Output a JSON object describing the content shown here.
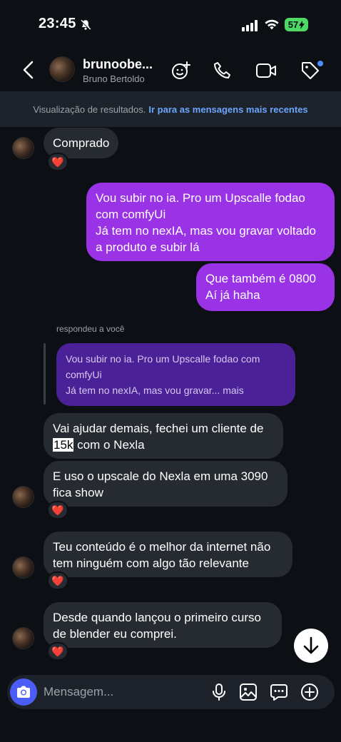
{
  "status_bar": {
    "time": "23:45",
    "battery": "57"
  },
  "header": {
    "username": "brunoobe...",
    "full_name": "Bruno Bertoldo"
  },
  "banner": {
    "text": "Visualização de resultados.",
    "link": "Ir para as mensagens mais recentes"
  },
  "messages": [
    {
      "from": "them",
      "text": "Comprado",
      "reaction": "❤️"
    },
    {
      "from": "me",
      "line1": "Vou subir no ia. Pro um Upscalle fodao",
      "line2": "com comfyUi",
      "line3": "Já tem no nexIA, mas vou gravar voltado",
      "line4": "a produto e subir lá"
    },
    {
      "from": "me",
      "line1": "Que também é 0800",
      "line2": "Aí já haha"
    },
    {
      "from": "them",
      "line1": "Vai ajudar demais, fechei um cliente de",
      "line2_highlight": "15k",
      "line2_rest": " com o Nexla"
    },
    {
      "from": "them",
      "line1": "E uso o upscale do Nexla em uma 3090",
      "line2": "fica show",
      "reaction": "❤️"
    },
    {
      "from": "them",
      "line1": "Teu conteúdo é o melhor da internet não",
      "line2": "tem ninguém com algo tão relevante",
      "reaction": "❤️"
    },
    {
      "from": "them",
      "line1": "Desde quando lançou o primeiro curso",
      "line2": "de blender eu comprei.",
      "reaction": "❤️"
    }
  ],
  "reply": {
    "label": "respondeu a você",
    "quote_line1": "Vou subir no ia. Pro um Upscalle fodao com",
    "quote_line2": "comfyUi",
    "quote_line3": "Já tem no nexIA, mas vou gravar... mais"
  },
  "composer": {
    "placeholder": "Mensagem..."
  },
  "colors": {
    "background": "#0c0f14",
    "outgoing_bubble": "#9a33e6",
    "incoming_bubble": "#262a31",
    "quote_bubble": "#4a2196",
    "link": "#6aa6ff",
    "camera_button": "#4c5cf6"
  },
  "icons": [
    "back-icon",
    "sticker-icon",
    "phone-icon",
    "video-icon",
    "tag-icon",
    "camera-icon",
    "mic-icon",
    "gallery-icon",
    "chat-icon",
    "plus-icon",
    "arrow-down-icon"
  ]
}
